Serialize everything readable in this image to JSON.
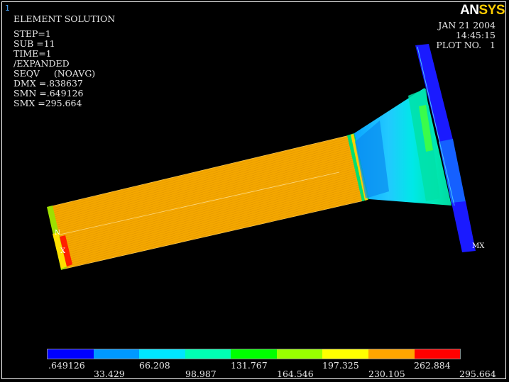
{
  "window_number": "1",
  "logo": {
    "part1": "AN",
    "part2": "SYS"
  },
  "info": {
    "title": "ELEMENT SOLUTION",
    "step": "STEP=1",
    "sub": "SUB =11",
    "time": "TIME=1",
    "expanded": "/EXPANDED",
    "seqv": "SEQV     (NOAVG)",
    "dmx": "DMX =.838637",
    "smn": "SMN =.649126",
    "smx": "SMX =295.664"
  },
  "date": {
    "date": "JAN 21 2004",
    "time": "14:45:15",
    "plot": "PLOT NO.   1"
  },
  "markers": {
    "mx": "MX",
    "mn_letter": "X",
    "mn_tag": "N"
  },
  "legend": {
    "colors": [
      "#0000ff",
      "#0099ff",
      "#00e6ff",
      "#00ffb3",
      "#00ff00",
      "#99ff00",
      "#ffff00",
      "#ffa500",
      "#ff0000"
    ],
    "labels_top": [
      ".649126",
      "66.208",
      "131.767",
      "197.325",
      "262.884"
    ],
    "labels_bottom": [
      "33.429",
      "98.987",
      "164.546",
      "230.105",
      "295.664"
    ]
  }
}
